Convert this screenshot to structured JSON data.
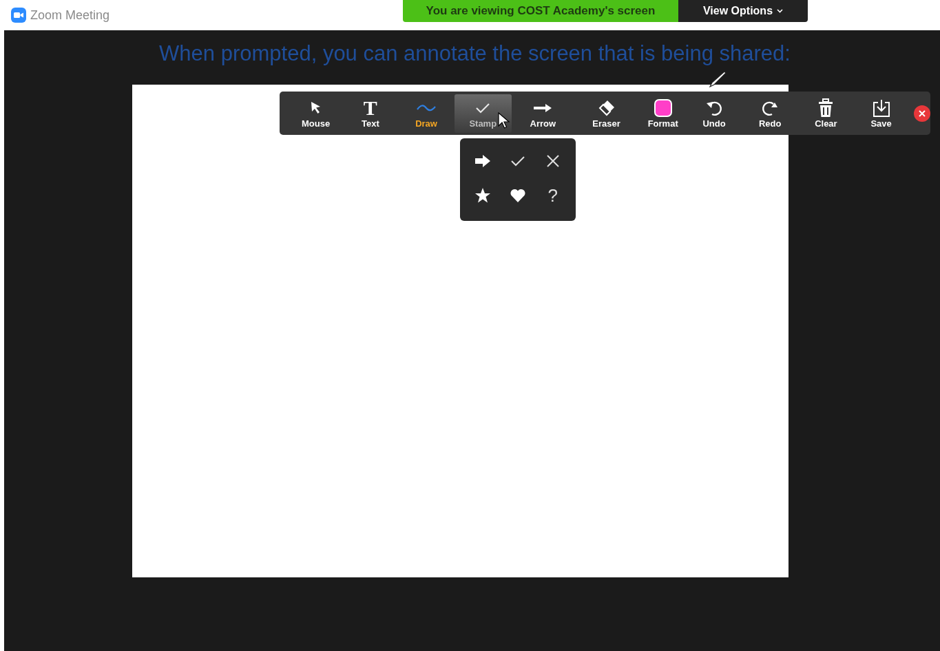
{
  "window": {
    "title": "Zoom Meeting"
  },
  "banner": {
    "text": "You are viewing COST Academy's screen"
  },
  "view_options": {
    "label": "View Options"
  },
  "caption": "When prompted, you can annotate the screen that is being shared:",
  "toolbar": [
    {
      "kind": "mouse",
      "label": "Mouse",
      "selected": false,
      "open": false
    },
    {
      "kind": "text",
      "label": "Text",
      "glyph": "T",
      "selected": false,
      "open": false
    },
    {
      "kind": "draw",
      "label": "Draw",
      "selected": true,
      "open": false
    },
    {
      "kind": "stamp",
      "label": "Stamp",
      "selected": false,
      "open": true
    },
    {
      "kind": "arrow",
      "label": "Arrow",
      "selected": false,
      "open": false
    },
    {
      "kind": "eraser",
      "label": "Eraser",
      "selected": false,
      "open": false
    },
    {
      "kind": "format",
      "label": "Format",
      "selected": false,
      "open": false
    },
    {
      "kind": "undo",
      "label": "Undo",
      "selected": false,
      "open": false
    },
    {
      "kind": "redo",
      "label": "Redo",
      "selected": false,
      "open": false
    },
    {
      "kind": "clear",
      "label": "Clear",
      "selected": false,
      "open": false
    },
    {
      "kind": "save",
      "label": "Save",
      "selected": false,
      "open": false
    }
  ],
  "stamps": [
    {
      "kind": "arrow"
    },
    {
      "kind": "check"
    },
    {
      "kind": "cross"
    },
    {
      "kind": "star"
    },
    {
      "kind": "heart"
    },
    {
      "kind": "question",
      "glyph": "?"
    }
  ]
}
